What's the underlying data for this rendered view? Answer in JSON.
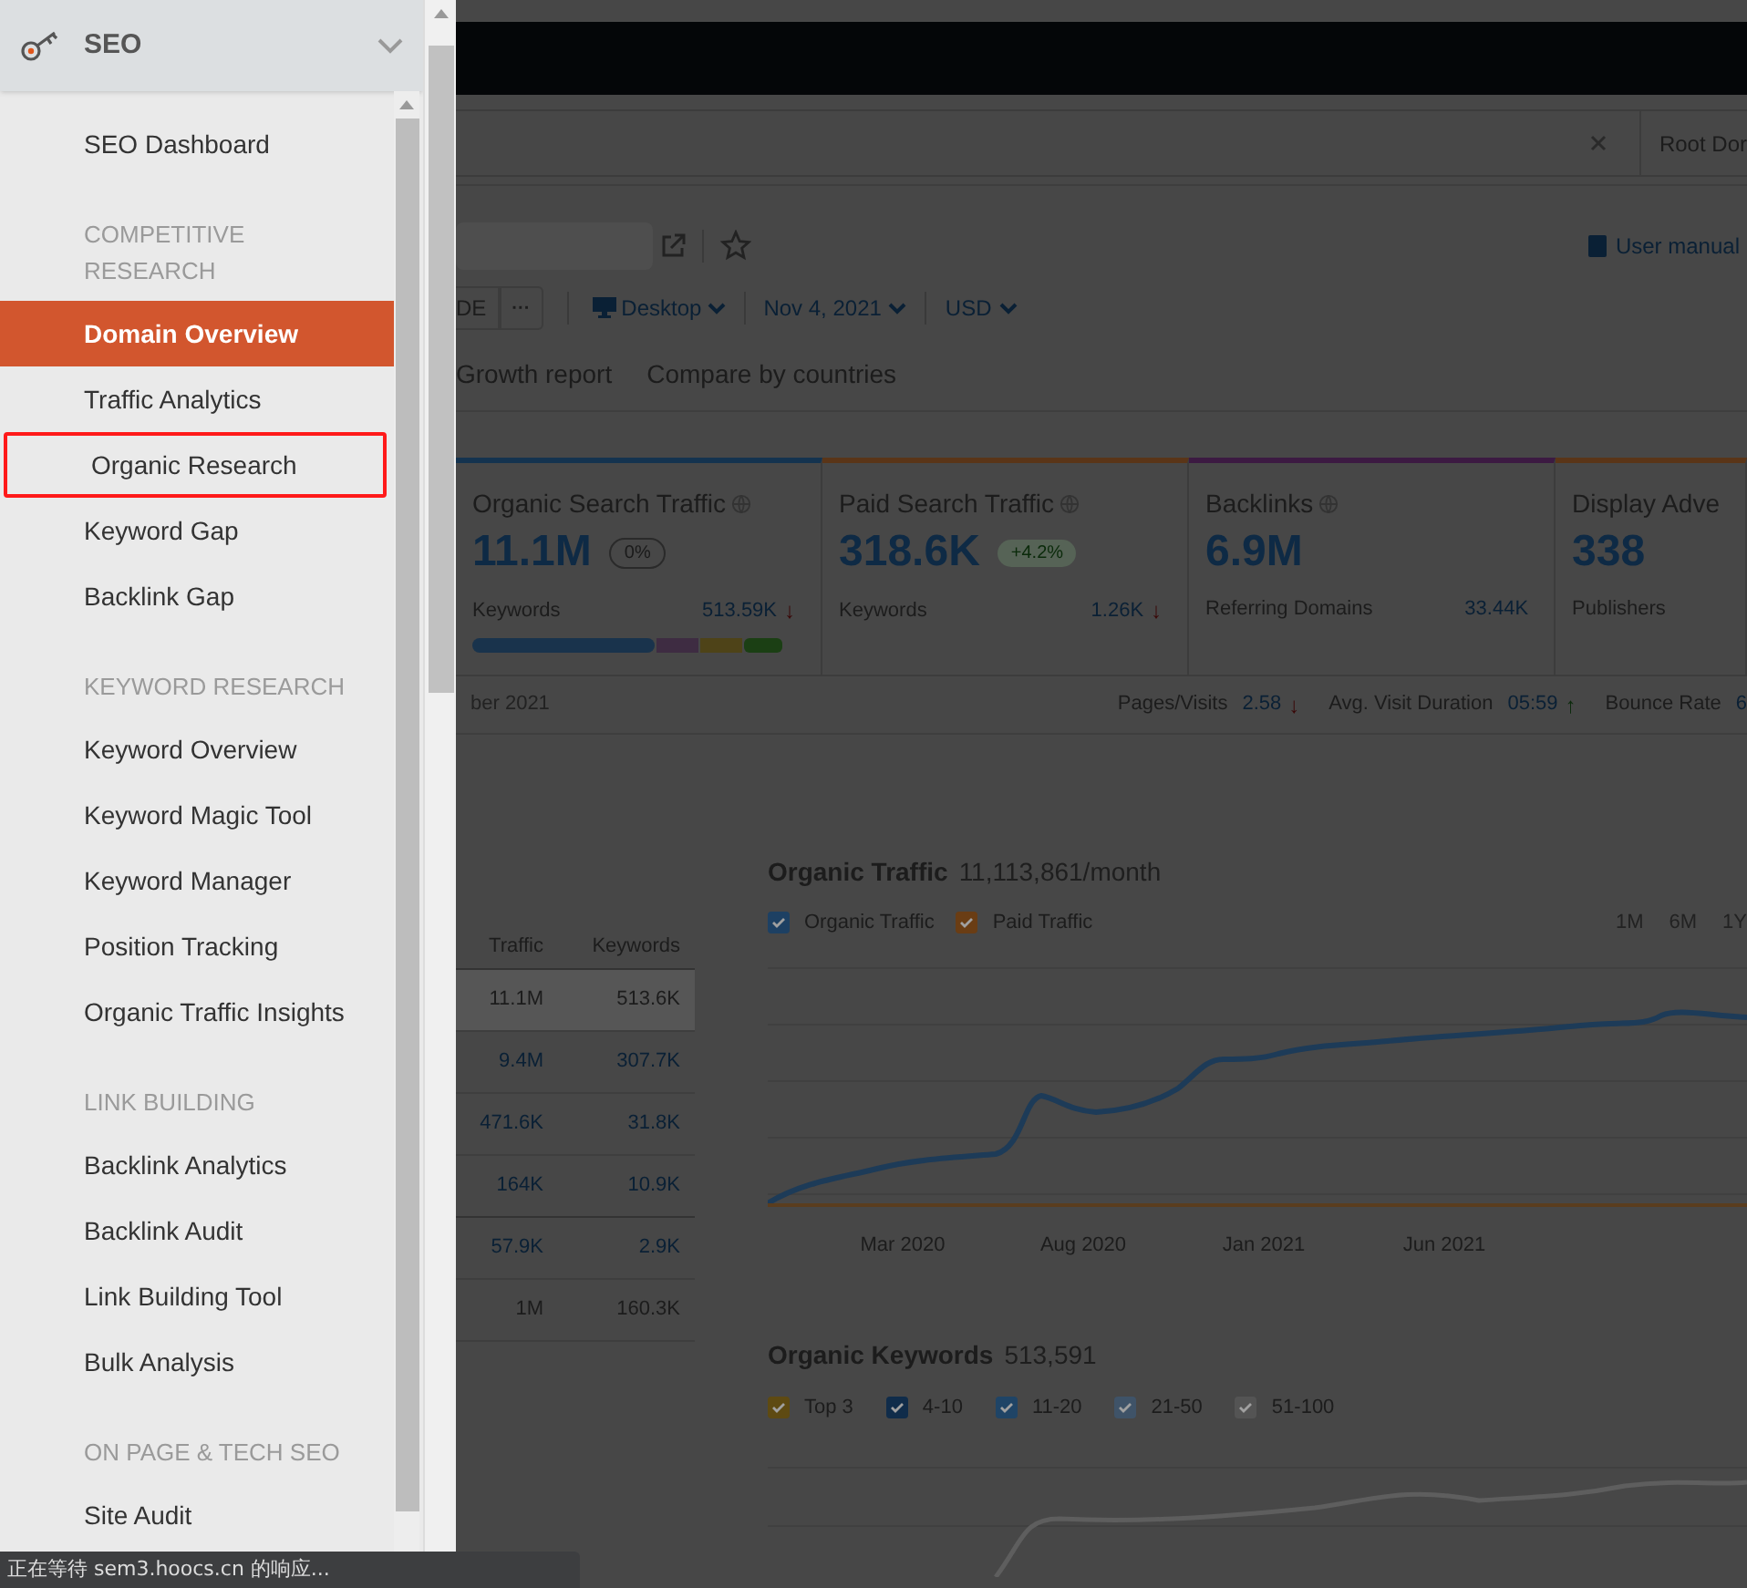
{
  "menu": {
    "title": "SEO",
    "expanded": true,
    "items": [
      {
        "kind": "link",
        "label": "SEO Dashboard",
        "selected": false,
        "outlined": false
      },
      {
        "kind": "section",
        "label": "COMPETITIVE RESEARCH"
      },
      {
        "kind": "link",
        "label": "Domain Overview",
        "selected": true,
        "outlined": false
      },
      {
        "kind": "link",
        "label": "Traffic Analytics",
        "selected": false,
        "outlined": false
      },
      {
        "kind": "link",
        "label": "Organic Research",
        "selected": false,
        "outlined": true
      },
      {
        "kind": "link",
        "label": "Keyword Gap",
        "selected": false,
        "outlined": false
      },
      {
        "kind": "link",
        "label": "Backlink Gap",
        "selected": false,
        "outlined": false
      },
      {
        "kind": "section",
        "label": "KEYWORD RESEARCH"
      },
      {
        "kind": "link",
        "label": "Keyword Overview",
        "selected": false,
        "outlined": false
      },
      {
        "kind": "link",
        "label": "Keyword Magic Tool",
        "selected": false,
        "outlined": false
      },
      {
        "kind": "link",
        "label": "Keyword Manager",
        "selected": false,
        "outlined": false
      },
      {
        "kind": "link",
        "label": "Position Tracking",
        "selected": false,
        "outlined": false
      },
      {
        "kind": "link",
        "label": "Organic Traffic Insights",
        "selected": false,
        "outlined": false
      },
      {
        "kind": "section",
        "label": "LINK BUILDING"
      },
      {
        "kind": "link",
        "label": "Backlink Analytics",
        "selected": false,
        "outlined": false
      },
      {
        "kind": "link",
        "label": "Backlink Audit",
        "selected": false,
        "outlined": false
      },
      {
        "kind": "link",
        "label": "Link Building Tool",
        "selected": false,
        "outlined": false
      },
      {
        "kind": "link",
        "label": "Bulk Analysis",
        "selected": false,
        "outlined": false
      },
      {
        "kind": "section",
        "label": "ON PAGE & TECH SEO"
      },
      {
        "kind": "link",
        "label": "Site Audit",
        "selected": false,
        "outlined": false
      }
    ]
  },
  "search": {
    "scope": "Root Dor"
  },
  "header": {
    "user_manual": "User manual",
    "db_button": "DE",
    "more_button": "···",
    "device": "Desktop",
    "date": "Nov 4, 2021",
    "currency": "USD"
  },
  "tabs": [
    {
      "label": "Growth report"
    },
    {
      "label": "Compare by countries"
    }
  ],
  "cards": [
    {
      "title": "Organic Search Traffic",
      "value": "11.1M",
      "badge": "0%",
      "badge_positive": false,
      "sub_label": "Keywords",
      "sub_value": "513.59K",
      "trend": "↓",
      "trend_up": false,
      "color": "#14334f"
    },
    {
      "title": "Paid Search Traffic",
      "value": "318.6K",
      "badge": "+4.2%",
      "badge_positive": true,
      "sub_label": "Keywords",
      "sub_value": "1.26K",
      "trend": "↓",
      "trend_up": false,
      "color": "#5a3518"
    },
    {
      "title": "Backlinks",
      "value": "6.9M",
      "sub_label": "Referring Domains",
      "sub_value": "33.44K",
      "color": "#3c1a42"
    },
    {
      "title": "Display Adve",
      "value": "338",
      "sub_label": "Publishers",
      "color": "#5a3518"
    }
  ],
  "stats_bar": {
    "period": "ber 2021",
    "metrics": [
      {
        "label": "Pages/Visits",
        "value": "2.58",
        "trend": "↓",
        "trend_up": false
      },
      {
        "label": "Avg. Visit Duration",
        "value": "05:59",
        "trend": "↑",
        "trend_up": true
      },
      {
        "label": "Bounce Rate",
        "value": "6"
      }
    ]
  },
  "table": {
    "columns": [
      "Traffic",
      "Keywords"
    ],
    "rows": [
      {
        "cells": [
          "11.1M",
          "513.6K"
        ],
        "selected": true
      },
      {
        "cells": [
          "9.4M",
          "307.7K"
        ],
        "selected": false
      },
      {
        "cells": [
          "471.6K",
          "31.8K"
        ],
        "selected": false
      },
      {
        "cells": [
          "164K",
          "10.9K"
        ],
        "selected": false
      },
      {
        "cells": [
          "57.9K",
          "2.9K"
        ],
        "selected": false
      },
      {
        "cells": [
          "1M",
          "160.3K"
        ],
        "selected": false
      }
    ]
  },
  "traffic_chart": {
    "title": "Organic Traffic",
    "total": "11,113,861/month",
    "legend": [
      {
        "label": "Organic Traffic",
        "checked": true,
        "color": "#1d4063"
      },
      {
        "label": "Paid Traffic",
        "checked": true,
        "color": "#6a3d14"
      }
    ],
    "ranges": [
      "1M",
      "6M",
      "1Y"
    ],
    "x_labels": [
      "Mar 2020",
      "Aug 2020",
      "Jan 2021",
      "Jun 2021"
    ]
  },
  "keywords_chart": {
    "title": "Organic Keywords",
    "total": "513,591",
    "legend": [
      {
        "label": "Top 3",
        "checked": true,
        "color": "#5e4a12"
      },
      {
        "label": "4-10",
        "checked": true,
        "color": "#102c4a"
      },
      {
        "label": "11-20",
        "checked": true,
        "color": "#1f4466"
      },
      {
        "label": "21-50",
        "checked": true,
        "color": "#3f5368"
      },
      {
        "label": "51-100",
        "checked": true,
        "color": "#545454"
      }
    ]
  },
  "status_bar": "正在等待 sem3.hoocs.cn 的响应..."
}
